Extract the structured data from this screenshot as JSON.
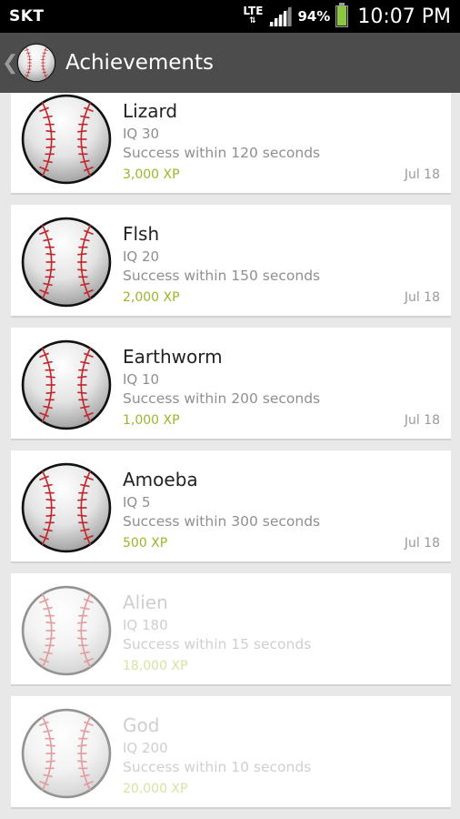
{
  "status_bar": {
    "carrier": "SKT",
    "network": "LTE",
    "network_arrows": "⇅",
    "battery_percent": "94%",
    "battery_level": 0.94,
    "time": "10:07 PM"
  },
  "action_bar": {
    "title": "Achievements",
    "back_icon": "chevron-left-icon",
    "app_icon": "baseball-icon"
  },
  "colors": {
    "action_bar": "#4c4c4c",
    "xp_green": "#9bb62a",
    "stitch_red": "#c0262b"
  },
  "achievements": [
    {
      "name": "Lizard",
      "iq": "IQ 30",
      "description": "Success within 120 seconds",
      "xp": "3,000 XP",
      "date": "Jul 18",
      "unlocked": true
    },
    {
      "name": "Flsh",
      "iq": "IQ 20",
      "description": "Success within 150 seconds",
      "xp": "2,000 XP",
      "date": "Jul 18",
      "unlocked": true
    },
    {
      "name": "Earthworm",
      "iq": "IQ 10",
      "description": "Success within 200 seconds",
      "xp": "1,000 XP",
      "date": "Jul 18",
      "unlocked": true
    },
    {
      "name": "Amoeba",
      "iq": "IQ 5",
      "description": "Success within 300 seconds",
      "xp": "500 XP",
      "date": "Jul 18",
      "unlocked": true
    },
    {
      "name": "Alien",
      "iq": "IQ 180",
      "description": "Success within 15 seconds",
      "xp": "18,000 XP",
      "date": "",
      "unlocked": false
    },
    {
      "name": "God",
      "iq": "IQ 200",
      "description": "Success within 10 seconds",
      "xp": "20,000 XP",
      "date": "",
      "unlocked": false
    }
  ]
}
